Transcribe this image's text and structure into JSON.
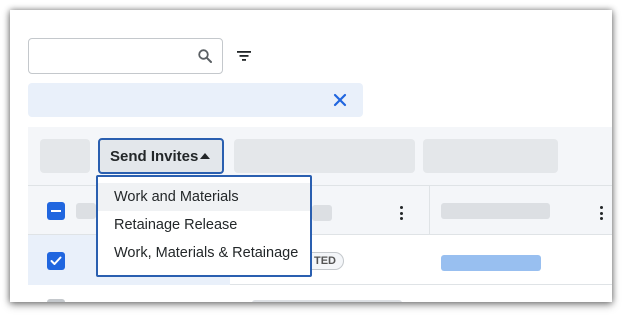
{
  "search": {
    "value": "",
    "placeholder": ""
  },
  "toolbar": {
    "send_invites_label": "Send Invites"
  },
  "dropdown": {
    "items": [
      {
        "label": "Work and Materials"
      },
      {
        "label": "Retainage Release"
      },
      {
        "label": "Work, Materials & Retainage"
      }
    ]
  },
  "table": {
    "rows": [
      {
        "status_badge": "TED"
      }
    ]
  },
  "colors": {
    "accent": "#2066df",
    "focus_border": "#2a5fb0",
    "selection_bg": "#e9f0fa"
  },
  "icons": [
    "search-icon",
    "filter-icon",
    "close-icon",
    "caret-up-icon",
    "more-vertical-icon",
    "checkbox-check-icon"
  ]
}
